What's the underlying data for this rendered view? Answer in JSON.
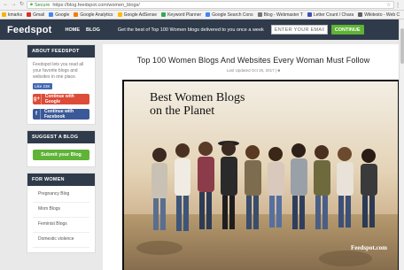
{
  "browser": {
    "secure_label": "Secure",
    "url": "https://blog.feedspot.com/women_blogs/",
    "bookmarks": [
      {
        "label": "kmarks",
        "color": "#f4b400"
      },
      {
        "label": "Gmail",
        "color": "#d93025"
      },
      {
        "label": "Google",
        "color": "#4285f4"
      },
      {
        "label": "Google Analytics",
        "color": "#f57c00"
      },
      {
        "label": "Google AdSense",
        "color": "#fbbc05"
      },
      {
        "label": "Keyword Planner",
        "color": "#34a853"
      },
      {
        "label": "Google Search Cons",
        "color": "#4285f4"
      },
      {
        "label": "Blog - Webmaster T",
        "color": "#757575"
      },
      {
        "label": "Letter Count / Chara",
        "color": "#3f51b5"
      },
      {
        "label": "Wikitesto - Web C",
        "color": "#616161"
      }
    ]
  },
  "header": {
    "logo": "Feedspot",
    "nav": [
      "HOME",
      "BLOG"
    ],
    "tagline": "Get the best of Top 100 Women blogs delivered to you once a week",
    "email_placeholder": "ENTER YOUR EMAIL",
    "continue_label": "CONTINUE"
  },
  "sidebar": {
    "about": {
      "heading": "ABOUT FEEDSPOT",
      "text": "Feedspot lets you read all your favorite blogs and websites in one place.",
      "like_label": "Like 23K",
      "google_label": "Continue with Google",
      "facebook_label": "Continue with Facebook"
    },
    "suggest": {
      "heading": "SUGGEST A BLOG",
      "submit_label": "Submit your Blog"
    },
    "for_women": {
      "heading": "FOR WOMEN",
      "items": [
        "Pregnancy Blog",
        "Mom Blogs",
        "Feminist Blogs",
        "Domestic violence"
      ]
    }
  },
  "main": {
    "title": "Top 100 Women Blogs And Websites Every Woman Must Follow",
    "updated": "Last Updated Oct 26, 2017 |",
    "hero": {
      "title_line1": "Best Women Blogs",
      "title_line2": "on the Planet",
      "credit": "Feedspot.com"
    }
  }
}
